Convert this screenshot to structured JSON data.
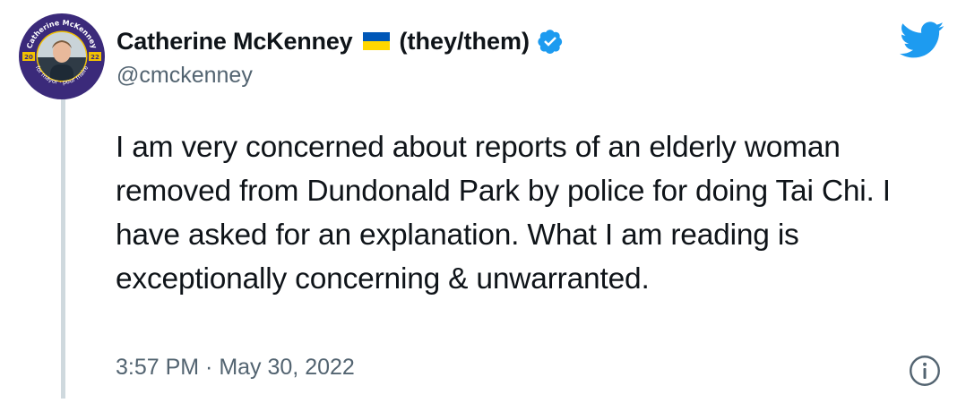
{
  "author": {
    "display_name": "Catherine McKenney",
    "pronouns": "(they/them)",
    "handle": "@cmckenney",
    "flag_icon": "ukraine-flag-icon",
    "verified_icon": "verified-badge-icon",
    "avatar_badge_text": "Catherine McKenney",
    "avatar_badge_bottom": "for mayor · pour maire",
    "avatar_year_left": "20",
    "avatar_year_right": "22"
  },
  "tweet": {
    "text": "I am very concerned about reports of an elderly woman removed from Dundonald Park by police for doing Tai Chi. I have asked for an explanation. What I am reading is exceptionally concerning & unwarranted.",
    "timestamp": "3:57 PM · May 30, 2022"
  },
  "icons": {
    "logo": "twitter-bird-icon",
    "info": "info-icon"
  },
  "colors": {
    "text": "#0f1419",
    "secondary": "#536471",
    "brand": "#1d9bf0",
    "thread_line": "#cfd9de",
    "avatar_ring": "#3b2a7a",
    "flag_blue": "#0057b7",
    "flag_yellow": "#ffd700"
  }
}
